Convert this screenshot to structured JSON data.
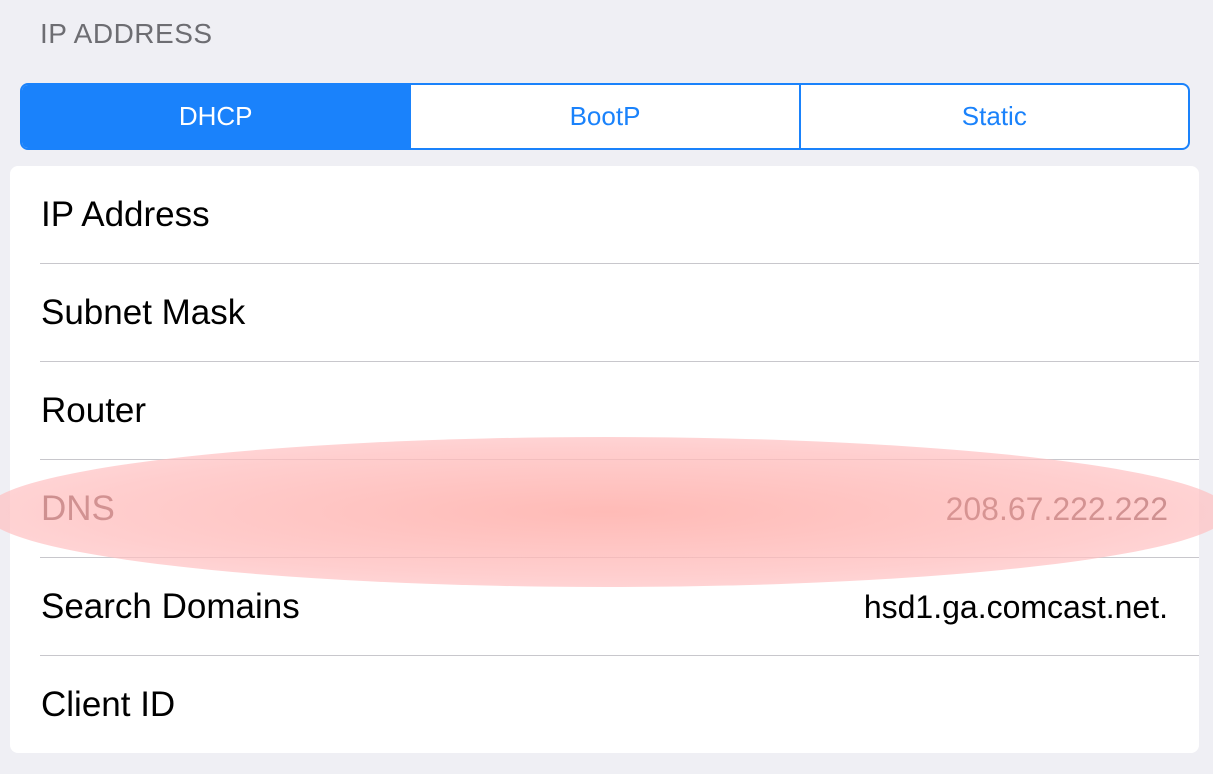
{
  "section": {
    "header": "IP ADDRESS"
  },
  "segmented_control": {
    "options": [
      "DHCP",
      "BootP",
      "Static"
    ],
    "selected": "DHCP"
  },
  "rows": [
    {
      "label": "IP Address",
      "value": ""
    },
    {
      "label": "Subnet Mask",
      "value": ""
    },
    {
      "label": "Router",
      "value": ""
    },
    {
      "label": "DNS",
      "value": "208.67.222.222"
    },
    {
      "label": "Search Domains",
      "value": "hsd1.ga.comcast.net."
    },
    {
      "label": "Client ID",
      "value": ""
    }
  ],
  "colors": {
    "accent": "#1a82fb",
    "background": "#efeff4",
    "highlight": "#ffb8b8"
  }
}
